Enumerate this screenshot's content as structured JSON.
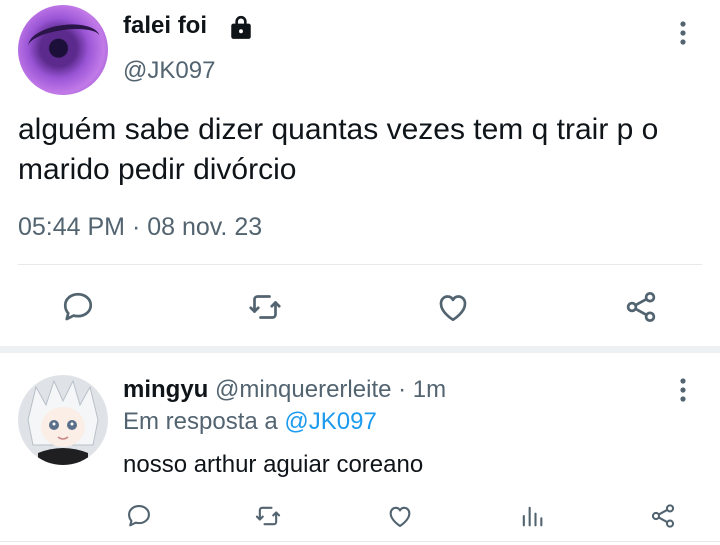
{
  "tweet": {
    "display_name": "falei foi",
    "handle": "@JK097",
    "text": "alguém sabe dizer quantas vezes tem q trair p o marido pedir divórcio",
    "timestamp": "05:44 PM · 08 nov. 23"
  },
  "reply": {
    "display_name": "mingyu",
    "handle": "@minquererleite",
    "separator": "·",
    "time": "1m",
    "reply_prefix": "Em resposta a",
    "reply_mention": "@JK097",
    "text": "nosso arthur aguiar coreano"
  },
  "icons": {
    "reply": "comment-icon",
    "retweet": "retweet-icon",
    "like": "heart-icon",
    "views": "analytics-icon",
    "share": "share-icon",
    "more": "more-vertical-icon",
    "lock": "lock-icon"
  },
  "colors": {
    "text": "#0f1419",
    "secondary": "#536471",
    "link": "#1d9bf0",
    "divider": "#e6e9ec"
  }
}
